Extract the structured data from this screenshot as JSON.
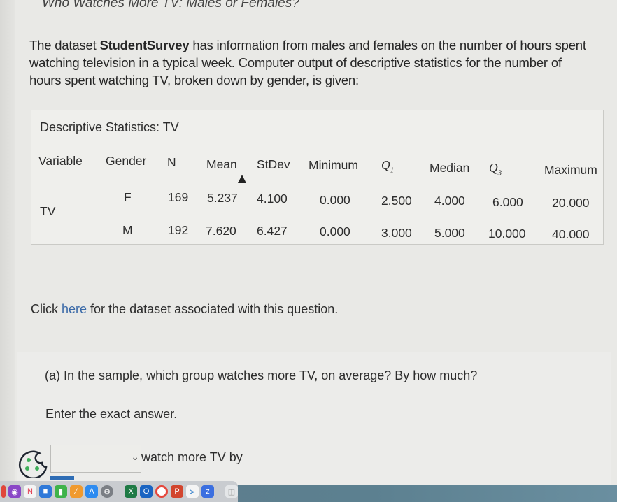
{
  "page": {
    "title": "Who Watches More TV: Males or Females?"
  },
  "intro": {
    "before": "The dataset ",
    "dataset_name": "StudentSurvey",
    "after": " has information from males and females on the number of hours spent watching television in a typical week. Computer output of descriptive statistics for the number of hours spent watching TV, broken down by gender, is given:"
  },
  "stats": {
    "title": "Descriptive Statistics: TV",
    "headers": {
      "variable": "Variable",
      "gender": "Gender",
      "n": "N",
      "mean": "Mean",
      "stdev": "StDev",
      "minimum": "Minimum",
      "q1_letter": "Q",
      "q1_sub": "1",
      "median": "Median",
      "q3_letter": "Q",
      "q3_sub": "3",
      "maximum": "Maximum"
    },
    "variable": "TV",
    "rows": [
      {
        "gender": "F",
        "n": "169",
        "mean": "5.237",
        "stdev": "4.100",
        "minimum": "0.000",
        "q1": "2.500",
        "median": "4.000",
        "q3": "6.000",
        "maximum": "20.000"
      },
      {
        "gender": "M",
        "n": "192",
        "mean": "7.620",
        "stdev": "6.427",
        "minimum": "0.000",
        "q1": "3.000",
        "median": "5.000",
        "q3": "10.000",
        "maximum": "40.000"
      }
    ]
  },
  "dataset_link": {
    "prefix": "Click ",
    "link_text": "here",
    "suffix": " for the dataset associated with this question."
  },
  "part_a": {
    "question": "(a) In the sample, which group watches more TV, on average? By how much?",
    "instruction": "Enter the exact answer.",
    "select_value": "",
    "after_select": "watch more TV by"
  },
  "dock": {
    "icons": [
      "podcasts-icon",
      "news-icon",
      "keynote-icon",
      "numbers-icon",
      "pages-icon",
      "app-store-icon",
      "system-settings-icon",
      "excel-icon",
      "outlook-icon",
      "chrome-icon",
      "powerpoint-icon",
      "vscode-icon",
      "zoom-icon",
      "trash-icon"
    ],
    "badge_count": ""
  }
}
